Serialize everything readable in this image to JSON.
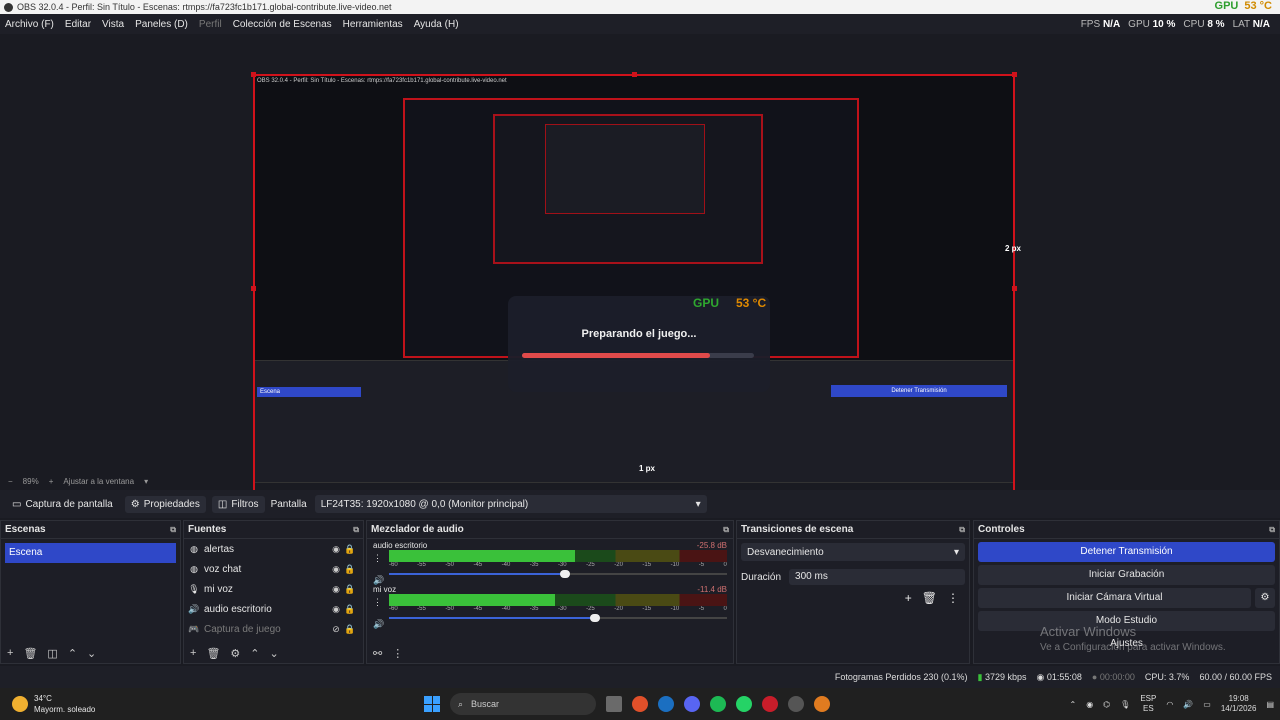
{
  "window": {
    "title": "OBS 32.0.4 - Perfil: Sin Título - Escenas: rtmps://fa723fc1b171.global-contribute.live-video.net",
    "overlay_gpu": "GPU",
    "overlay_temp": "53 °C"
  },
  "menu": [
    "Archivo (F)",
    "Editar",
    "Vista",
    "Paneles (D)",
    "Perfil",
    "Colección de Escenas",
    "Herramientas",
    "Ayuda (H)"
  ],
  "stats": {
    "fps_label": "FPS",
    "fps": "N/A",
    "gpu_label": "GPU",
    "gpu": "10 %",
    "cpu_label": "CPU",
    "cpu": "8 %",
    "lat_label": "LAT",
    "lat": "N/A"
  },
  "preview": {
    "loading_text": "Preparando el juego...",
    "loading_progress": 0.81,
    "gpu": "GPU",
    "temp": "53 °C",
    "px_right": "2 px",
    "px_bottom": "1 px",
    "nested_ctrl": "Detener Transmisión",
    "nested_scene": "Escena"
  },
  "zoom": {
    "level": "89%",
    "fit": "Ajustar a la ventana"
  },
  "toolbar": {
    "source": "Captura de pantalla",
    "properties": "Propiedades",
    "filters": "Filtros",
    "display_label": "Pantalla",
    "display_value": "LF24T35: 1920x1080 @ 0,0 (Monitor principal)"
  },
  "scenes": {
    "title": "Escenas",
    "items": [
      "Escena"
    ]
  },
  "sources": {
    "title": "Fuentes",
    "items": [
      {
        "name": "alertas",
        "icon": "globe-icon",
        "visible": true
      },
      {
        "name": "voz chat",
        "icon": "globe-icon",
        "visible": true
      },
      {
        "name": "mi voz",
        "icon": "microphone-icon",
        "visible": true
      },
      {
        "name": "audio escritorio",
        "icon": "speaker-icon",
        "visible": true
      },
      {
        "name": "Captura de juego",
        "icon": "gamepad-icon",
        "visible": false
      }
    ]
  },
  "mixer": {
    "title": "Mezclador de audio",
    "scale": [
      "-60",
      "-55",
      "-50",
      "-45",
      "-40",
      "-35",
      "-30",
      "-25",
      "-20",
      "-15",
      "-10",
      "-5",
      "0"
    ],
    "tracks": [
      {
        "name": "audio escritorio",
        "db": "-25.8 dB",
        "level": 0.55,
        "peak": 0.56,
        "volume": 0.52
      },
      {
        "name": "mi voz",
        "db": "-11.4 dB",
        "level": 0.49,
        "peak": 0.59,
        "volume": 0.61
      }
    ]
  },
  "transitions": {
    "title": "Transiciones de escena",
    "selected": "Desvanecimiento",
    "duration_label": "Duración",
    "duration": "300 ms"
  },
  "controls": {
    "title": "Controles",
    "stop_stream": "Detener Transmisión",
    "start_rec": "Iniciar Grabación",
    "start_vcam": "Iniciar Cámara Virtual",
    "studio": "Modo Estudio",
    "settings": "Ajustes"
  },
  "watermark": {
    "line1": "Activar Windows",
    "line2": "Ve a Configuración para activar Windows."
  },
  "status": {
    "dropped": "Fotogramas Perdidos 230 (0.1%)",
    "bitrate": "3729 kbps",
    "stream_time": "01:55:08",
    "rec_time": "00:00:00",
    "cpu": "CPU: 3.7%",
    "fps": "60.00 / 60.00 FPS"
  },
  "taskbar": {
    "temp": "34°C",
    "weather": "Mayorm. soleado",
    "search": "Buscar",
    "lang1": "ESP",
    "lang2": "ES",
    "time": "19:08",
    "date": "14/1/2026"
  },
  "colors": {
    "accent": "#2f48c8",
    "border_red": "#d0121b",
    "meter_green": "#3ac13a"
  }
}
